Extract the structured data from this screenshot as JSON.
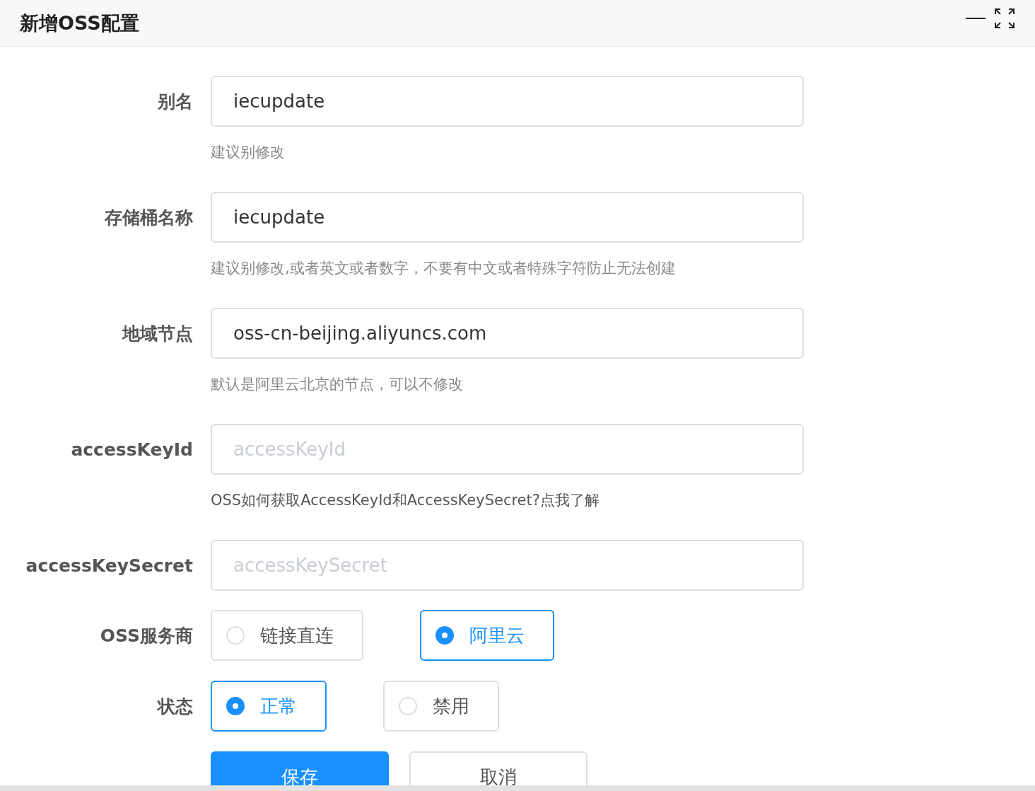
{
  "window": {
    "title": "新增OSS配置"
  },
  "fields": [
    {
      "label": "别名",
      "value": "iecupdate",
      "hint": {
        "kind": "text",
        "text": "建议别修改"
      }
    },
    {
      "label": "存储桶名称",
      "value": "iecupdate",
      "hint": {
        "kind": "text",
        "text": "建议别修改,或者英文或者数字，不要有中文或者特殊字符防止无法创建"
      }
    },
    {
      "label": "地域节点",
      "value": "oss-cn-beijing.aliyuncs.com",
      "hint": {
        "kind": "text",
        "text": "默认是阿里云北京的节点，可以不修改"
      }
    },
    {
      "label": "accessKeyId",
      "placeholder": "accessKeyId",
      "hint": {
        "kind": "link",
        "text": "OSS如何获取AccessKeyId和AccessKeySecret?点我了解"
      }
    },
    {
      "label": "accessKeySecret",
      "placeholder": "accessKeySecret"
    }
  ],
  "radio_groups": [
    {
      "label": "OSS服务商",
      "options": [
        {
          "label": "链接直连",
          "selected": false
        },
        {
          "label": "阿里云",
          "selected": true
        }
      ]
    },
    {
      "label": "状态",
      "options": [
        {
          "label": "正常",
          "selected": true
        },
        {
          "label": "禁用",
          "selected": false
        }
      ]
    }
  ],
  "buttons": [
    {
      "label": "保存",
      "kind": "primary"
    },
    {
      "label": "取消",
      "kind": "default"
    }
  ]
}
